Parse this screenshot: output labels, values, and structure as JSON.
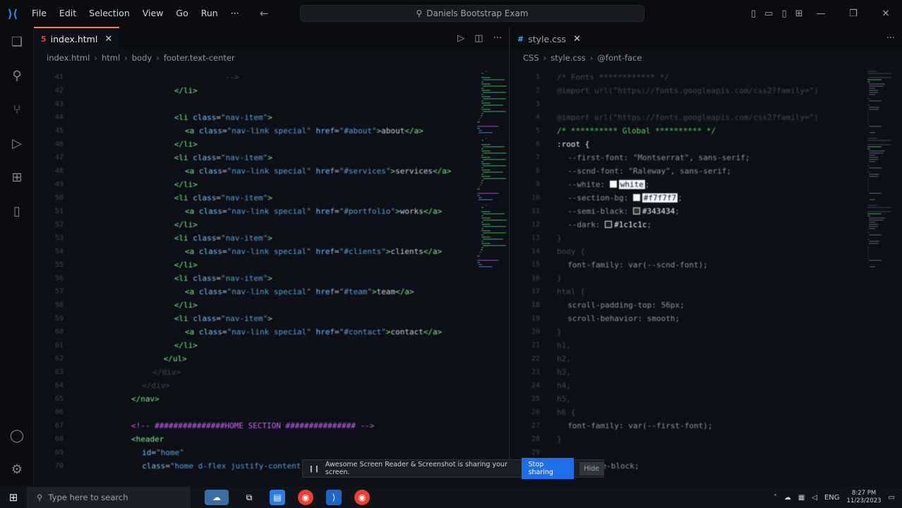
{
  "titlebar": {
    "menu": [
      "File",
      "Edit",
      "Selection",
      "View",
      "Go",
      "Run",
      "···"
    ],
    "search_text": "Daniels Bootstrap Exam"
  },
  "left_editor": {
    "tab_label": "index.html",
    "breadcrumb": [
      "index.html",
      "html",
      "body",
      "footer.text-center"
    ],
    "lines": [
      {
        "n": "41",
        "indent": 24,
        "parts": [
          {
            "c": "dimmed",
            "t": "    -->"
          }
        ]
      },
      {
        "n": "42",
        "indent": 18,
        "parts": [
          {
            "c": "tag",
            "t": "</li>"
          }
        ]
      },
      {
        "n": "43",
        "indent": 0,
        "parts": []
      },
      {
        "n": "44",
        "indent": 18,
        "parts": [
          {
            "c": "tag",
            "t": "<li "
          },
          {
            "c": "attr",
            "t": "class"
          },
          {
            "c": "plain",
            "t": "="
          },
          {
            "c": "str",
            "t": "\"nav-item\""
          },
          {
            "c": "tag",
            "t": ">"
          }
        ]
      },
      {
        "n": "45",
        "indent": 20,
        "parts": [
          {
            "c": "tag",
            "t": "<a "
          },
          {
            "c": "attr",
            "t": "class"
          },
          {
            "c": "plain",
            "t": "="
          },
          {
            "c": "str",
            "t": "\"nav-link special\" "
          },
          {
            "c": "attr",
            "t": "href"
          },
          {
            "c": "plain",
            "t": "="
          },
          {
            "c": "str",
            "t": "\"#about\""
          },
          {
            "c": "tag",
            "t": ">"
          },
          {
            "c": "plain",
            "t": "about"
          },
          {
            "c": "tag",
            "t": "</a>"
          }
        ]
      },
      {
        "n": "46",
        "indent": 18,
        "parts": [
          {
            "c": "tag",
            "t": "</li>"
          }
        ]
      },
      {
        "n": "47",
        "indent": 18,
        "parts": [
          {
            "c": "tag",
            "t": "<li "
          },
          {
            "c": "attr",
            "t": "class"
          },
          {
            "c": "plain",
            "t": "="
          },
          {
            "c": "str",
            "t": "\"nav-item\""
          },
          {
            "c": "tag",
            "t": ">"
          }
        ]
      },
      {
        "n": "48",
        "indent": 20,
        "parts": [
          {
            "c": "tag",
            "t": "<a "
          },
          {
            "c": "attr",
            "t": "class"
          },
          {
            "c": "plain",
            "t": "="
          },
          {
            "c": "str",
            "t": "\"nav-link special\" "
          },
          {
            "c": "attr",
            "t": "href"
          },
          {
            "c": "plain",
            "t": "="
          },
          {
            "c": "str",
            "t": "\"#services\""
          },
          {
            "c": "tag",
            "t": ">"
          },
          {
            "c": "plain",
            "t": "services"
          },
          {
            "c": "tag",
            "t": "</a>"
          }
        ]
      },
      {
        "n": "49",
        "indent": 18,
        "parts": [
          {
            "c": "tag",
            "t": "</li>"
          }
        ]
      },
      {
        "n": "50",
        "indent": 18,
        "parts": [
          {
            "c": "tag",
            "t": "<li "
          },
          {
            "c": "attr",
            "t": "class"
          },
          {
            "c": "plain",
            "t": "="
          },
          {
            "c": "str",
            "t": "\"nav-item\""
          },
          {
            "c": "tag",
            "t": ">"
          }
        ]
      },
      {
        "n": "51",
        "indent": 20,
        "parts": [
          {
            "c": "tag",
            "t": "<a "
          },
          {
            "c": "attr",
            "t": "class"
          },
          {
            "c": "plain",
            "t": "="
          },
          {
            "c": "str",
            "t": "\"nav-link special\" "
          },
          {
            "c": "attr",
            "t": "href"
          },
          {
            "c": "plain",
            "t": "="
          },
          {
            "c": "str",
            "t": "\"#portfolio\""
          },
          {
            "c": "tag",
            "t": ">"
          },
          {
            "c": "plain",
            "t": "works"
          },
          {
            "c": "tag",
            "t": "</a>"
          }
        ]
      },
      {
        "n": "52",
        "indent": 18,
        "parts": [
          {
            "c": "tag",
            "t": "</li>"
          }
        ]
      },
      {
        "n": "53",
        "indent": 18,
        "parts": [
          {
            "c": "tag",
            "t": "<li "
          },
          {
            "c": "attr",
            "t": "class"
          },
          {
            "c": "plain",
            "t": "="
          },
          {
            "c": "str",
            "t": "\"nav-item\""
          },
          {
            "c": "tag",
            "t": ">"
          }
        ]
      },
      {
        "n": "54",
        "indent": 20,
        "parts": [
          {
            "c": "tag",
            "t": "<a "
          },
          {
            "c": "attr",
            "t": "class"
          },
          {
            "c": "plain",
            "t": "="
          },
          {
            "c": "str",
            "t": "\"nav-link special\" "
          },
          {
            "c": "attr",
            "t": "href"
          },
          {
            "c": "plain",
            "t": "="
          },
          {
            "c": "str",
            "t": "\"#clients\""
          },
          {
            "c": "tag",
            "t": ">"
          },
          {
            "c": "plain",
            "t": "clients"
          },
          {
            "c": "tag",
            "t": "</a>"
          }
        ]
      },
      {
        "n": "55",
        "indent": 18,
        "parts": [
          {
            "c": "tag",
            "t": "</li>"
          }
        ]
      },
      {
        "n": "56",
        "indent": 18,
        "parts": [
          {
            "c": "tag",
            "t": "<li "
          },
          {
            "c": "attr",
            "t": "class"
          },
          {
            "c": "plain",
            "t": "="
          },
          {
            "c": "str",
            "t": "\"nav-item\""
          },
          {
            "c": "tag",
            "t": ">"
          }
        ]
      },
      {
        "n": "57",
        "indent": 20,
        "parts": [
          {
            "c": "tag",
            "t": "<a "
          },
          {
            "c": "attr",
            "t": "class"
          },
          {
            "c": "plain",
            "t": "="
          },
          {
            "c": "str",
            "t": "\"nav-link special\" "
          },
          {
            "c": "attr",
            "t": "href"
          },
          {
            "c": "plain",
            "t": "="
          },
          {
            "c": "str",
            "t": "\"#team\""
          },
          {
            "c": "tag",
            "t": ">"
          },
          {
            "c": "plain",
            "t": "team"
          },
          {
            "c": "tag",
            "t": "</a>"
          }
        ]
      },
      {
        "n": "58",
        "indent": 18,
        "parts": [
          {
            "c": "tag",
            "t": "</li>"
          }
        ]
      },
      {
        "n": "59",
        "indent": 18,
        "parts": [
          {
            "c": "tag",
            "t": "<li "
          },
          {
            "c": "attr",
            "t": "class"
          },
          {
            "c": "plain",
            "t": "="
          },
          {
            "c": "str",
            "t": "\"nav-item\""
          },
          {
            "c": "tag",
            "t": ">"
          }
        ]
      },
      {
        "n": "60",
        "indent": 20,
        "parts": [
          {
            "c": "tag",
            "t": "<a "
          },
          {
            "c": "attr",
            "t": "class"
          },
          {
            "c": "plain",
            "t": "="
          },
          {
            "c": "str",
            "t": "\"nav-link special\" "
          },
          {
            "c": "attr",
            "t": "href"
          },
          {
            "c": "plain",
            "t": "="
          },
          {
            "c": "str",
            "t": "\"#contact\""
          },
          {
            "c": "tag",
            "t": ">"
          },
          {
            "c": "plain",
            "t": "contact"
          },
          {
            "c": "tag",
            "t": "</a>"
          }
        ]
      },
      {
        "n": "61",
        "indent": 18,
        "parts": [
          {
            "c": "tag",
            "t": "</li>"
          }
        ]
      },
      {
        "n": "62",
        "indent": 16,
        "parts": [
          {
            "c": "tag",
            "t": "</ul>"
          }
        ]
      },
      {
        "n": "63",
        "indent": 14,
        "parts": [
          {
            "c": "dimmed",
            "t": "</div>"
          }
        ]
      },
      {
        "n": "64",
        "indent": 12,
        "parts": [
          {
            "c": "dimmed",
            "t": "</div>"
          }
        ]
      },
      {
        "n": "65",
        "indent": 10,
        "parts": [
          {
            "c": "tag",
            "t": "</nav>"
          }
        ]
      },
      {
        "n": "66",
        "indent": 0,
        "parts": []
      },
      {
        "n": "67",
        "indent": 10,
        "parts": [
          {
            "c": "comment",
            "t": "<!-- ###############HOME SECTION ############### -->"
          }
        ]
      },
      {
        "n": "68",
        "indent": 10,
        "parts": [
          {
            "c": "tag",
            "t": "<header"
          }
        ]
      },
      {
        "n": "69",
        "indent": 12,
        "parts": [
          {
            "c": "attr",
            "t": "id"
          },
          {
            "c": "plain",
            "t": "="
          },
          {
            "c": "str",
            "t": "\"home\""
          }
        ]
      },
      {
        "n": "70",
        "indent": 12,
        "parts": [
          {
            "c": "attr",
            "t": "class"
          },
          {
            "c": "plain",
            "t": "="
          },
          {
            "c": "str",
            "t": "\"home d-flex justify-content"
          }
        ]
      }
    ]
  },
  "right_editor": {
    "tab_label": "style.css",
    "breadcrumb": [
      "CSS",
      "style.css",
      "@font-face"
    ],
    "lines": [
      {
        "n": "1",
        "indent": 0,
        "parts": [
          {
            "c": "dimmed",
            "t": "/* Fonts ************ */"
          }
        ]
      },
      {
        "n": "2",
        "indent": 0,
        "parts": [
          {
            "c": "dimmed",
            "t": "@import url(\"https://fonts.googleapis.com/css2?family=\")"
          }
        ]
      },
      {
        "n": "3",
        "indent": 0,
        "parts": [
          {
            "c": "dimmed",
            "t": ""
          }
        ]
      },
      {
        "n": "4",
        "indent": 0,
        "parts": [
          {
            "c": "dimmed",
            "t": "@import url(\"https://fonts.googleapis.com/css2?family=\")"
          }
        ]
      },
      {
        "n": "5",
        "indent": 0,
        "parts": [
          {
            "c": "cmt-green",
            "t": "/* ********** Global ********** */"
          }
        ]
      },
      {
        "n": "6",
        "indent": 0,
        "parts": [
          {
            "c": "sel",
            "t": ":root {"
          }
        ]
      },
      {
        "n": "7",
        "indent": 2,
        "parts": [
          {
            "c": "prop",
            "t": "--first-font: \"Montserrat\", sans-serif;"
          }
        ]
      },
      {
        "n": "8",
        "indent": 2,
        "parts": [
          {
            "c": "prop",
            "t": "--scnd-font: \"Raleway\", sans-serif;"
          }
        ]
      },
      {
        "n": "9",
        "indent": 2,
        "parts": [
          {
            "c": "prop",
            "t": "--white: "
          },
          {
            "c": "swatch",
            "t": "#ffffff"
          },
          {
            "c": "hl",
            "t": "white"
          },
          {
            "c": "prop",
            "t": ";"
          }
        ]
      },
      {
        "n": "10",
        "indent": 2,
        "parts": [
          {
            "c": "prop",
            "t": "--section-bg: "
          },
          {
            "c": "swatch",
            "t": "#f7f7f7"
          },
          {
            "c": "hl",
            "t": "#f7f7f7"
          },
          {
            "c": "prop",
            "t": ";"
          }
        ]
      },
      {
        "n": "11",
        "indent": 2,
        "parts": [
          {
            "c": "prop",
            "t": "--semi-black: "
          },
          {
            "c": "swatch",
            "t": "#343434"
          },
          {
            "c": "sel",
            "t": "#343434"
          },
          {
            "c": "prop",
            "t": ";"
          }
        ]
      },
      {
        "n": "12",
        "indent": 2,
        "parts": [
          {
            "c": "prop",
            "t": "--dark: "
          },
          {
            "c": "swatch",
            "t": "#1c1c1c"
          },
          {
            "c": "sel",
            "t": "#1c1c1c"
          },
          {
            "c": "prop",
            "t": ";"
          }
        ]
      },
      {
        "n": "13",
        "indent": 0,
        "parts": [
          {
            "c": "dimmed",
            "t": "}"
          }
        ]
      },
      {
        "n": "14",
        "indent": 0,
        "parts": [
          {
            "c": "dimmed",
            "t": "body {"
          }
        ]
      },
      {
        "n": "15",
        "indent": 2,
        "parts": [
          {
            "c": "prop",
            "t": "font-family: var(--scnd-font);"
          }
        ]
      },
      {
        "n": "16",
        "indent": 0,
        "parts": [
          {
            "c": "dimmed",
            "t": "}"
          }
        ]
      },
      {
        "n": "17",
        "indent": 0,
        "parts": [
          {
            "c": "dimmed",
            "t": "html {"
          }
        ]
      },
      {
        "n": "18",
        "indent": 2,
        "parts": [
          {
            "c": "prop",
            "t": "scroll-padding-top: 56px;"
          }
        ]
      },
      {
        "n": "19",
        "indent": 2,
        "parts": [
          {
            "c": "prop",
            "t": "scroll-behavior: smooth;"
          }
        ]
      },
      {
        "n": "20",
        "indent": 0,
        "parts": [
          {
            "c": "dimmed",
            "t": "}"
          }
        ]
      },
      {
        "n": "21",
        "indent": 0,
        "parts": [
          {
            "c": "dimmed",
            "t": "h1,"
          }
        ]
      },
      {
        "n": "22",
        "indent": 0,
        "parts": [
          {
            "c": "dimmed",
            "t": "h2,"
          }
        ]
      },
      {
        "n": "23",
        "indent": 0,
        "parts": [
          {
            "c": "dimmed",
            "t": "h3,"
          }
        ]
      },
      {
        "n": "24",
        "indent": 0,
        "parts": [
          {
            "c": "dimmed",
            "t": "h4,"
          }
        ]
      },
      {
        "n": "25",
        "indent": 0,
        "parts": [
          {
            "c": "dimmed",
            "t": "h5,"
          }
        ]
      },
      {
        "n": "26",
        "indent": 0,
        "parts": [
          {
            "c": "dimmed",
            "t": "h6 {"
          }
        ]
      },
      {
        "n": "27",
        "indent": 2,
        "parts": [
          {
            "c": "prop",
            "t": "font-family: var(--first-font);"
          }
        ]
      },
      {
        "n": "28",
        "indent": 0,
        "parts": [
          {
            "c": "dimmed",
            "t": "}"
          }
        ]
      },
      {
        "n": "29",
        "indent": 0,
        "parts": []
      },
      {
        "n": "30",
        "indent": 4,
        "parts": [
          {
            "c": "prop",
            "t": "inline-block;"
          }
        ]
      }
    ]
  },
  "sharebar": {
    "text": "Awesome Screen Reader & Screenshot is sharing your screen.",
    "stop_label": "Stop sharing",
    "hide_label": "Hide"
  },
  "taskbar": {
    "search_placeholder": "Type here to search",
    "lang": "ENG",
    "time": "8:27 PM",
    "date": "11/23/2023"
  }
}
